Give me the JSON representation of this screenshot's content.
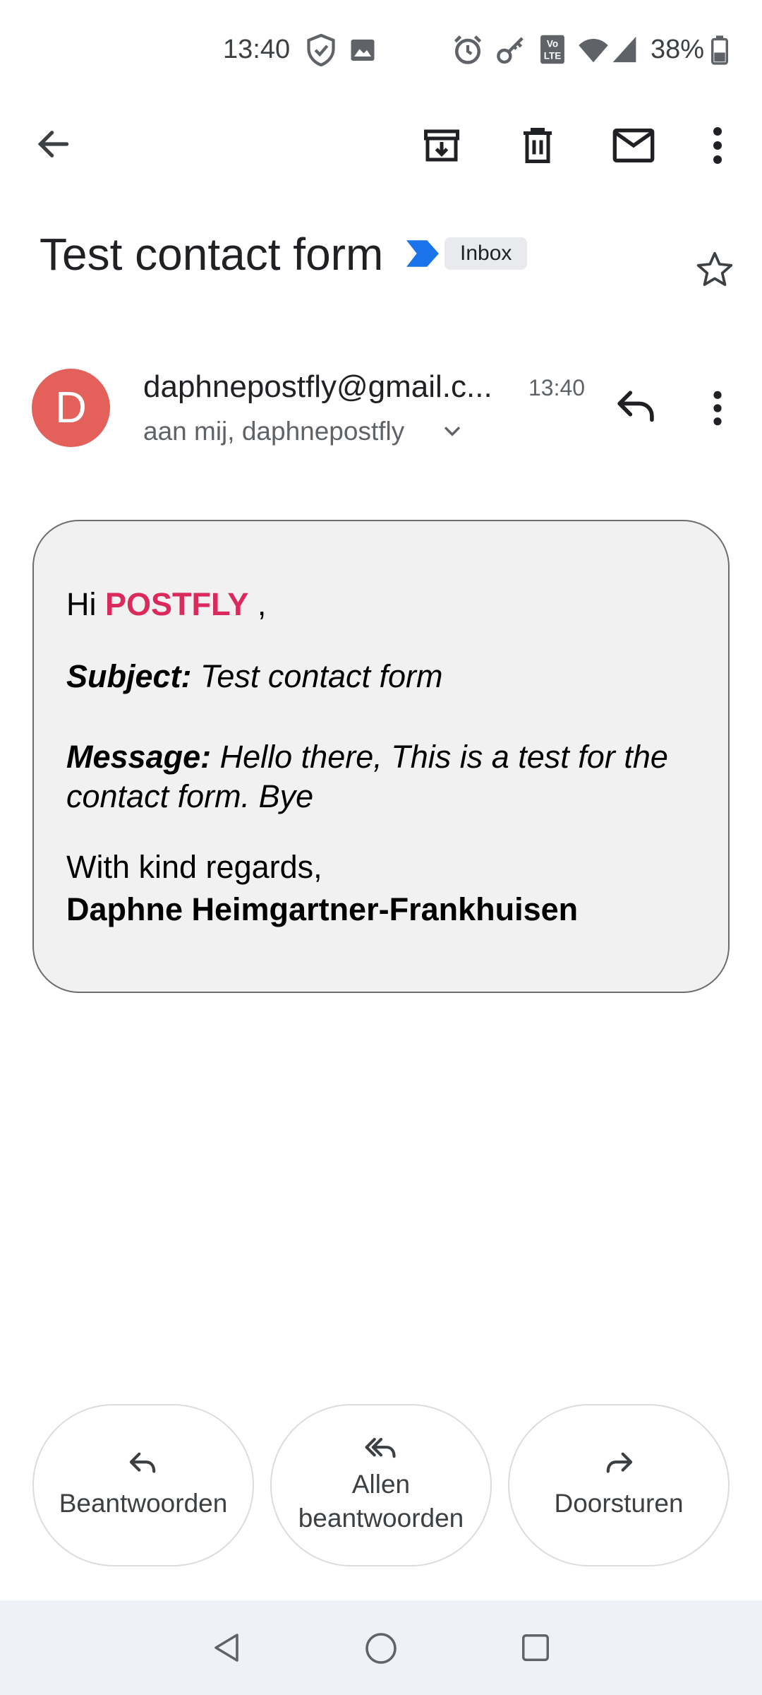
{
  "status_bar": {
    "time": "13:40",
    "battery": "38%",
    "icons": [
      "shield-check-icon",
      "image-icon",
      "alarm-icon",
      "key-icon",
      "volte-icon",
      "wifi-icon",
      "signal-icon",
      "battery-icon"
    ]
  },
  "toolbar": {
    "icons": [
      "back-arrow-icon",
      "archive-icon",
      "delete-icon",
      "mark-unread-icon",
      "more-vert-icon"
    ]
  },
  "email": {
    "subject": "Test contact form",
    "label": "Inbox",
    "sender_initial": "D",
    "sender": "daphnepostfly@gmail.c...",
    "time": "13:40",
    "recipients": "aan mij, daphnepostfly"
  },
  "message": {
    "greeting_prefix": "Hi",
    "greeting_name": "POSTFLY",
    "greeting_suffix": ",",
    "subject_label": "Subject:",
    "subject_value": "Test contact form",
    "message_label": "Message:",
    "message_value": "Hello there, This is a test for the contact form. Bye",
    "regards": "With kind regards,",
    "signature": "Daphne Heimgartner-Frankhuisen"
  },
  "actions": {
    "reply": "Beantwoorden",
    "reply_all_1": "Allen",
    "reply_all_2": "beantwoorden",
    "forward": "Doorsturen"
  },
  "colors": {
    "avatar": "#e4605b",
    "highlight": "#d92a5b",
    "important_marker": "#1a73e8"
  }
}
